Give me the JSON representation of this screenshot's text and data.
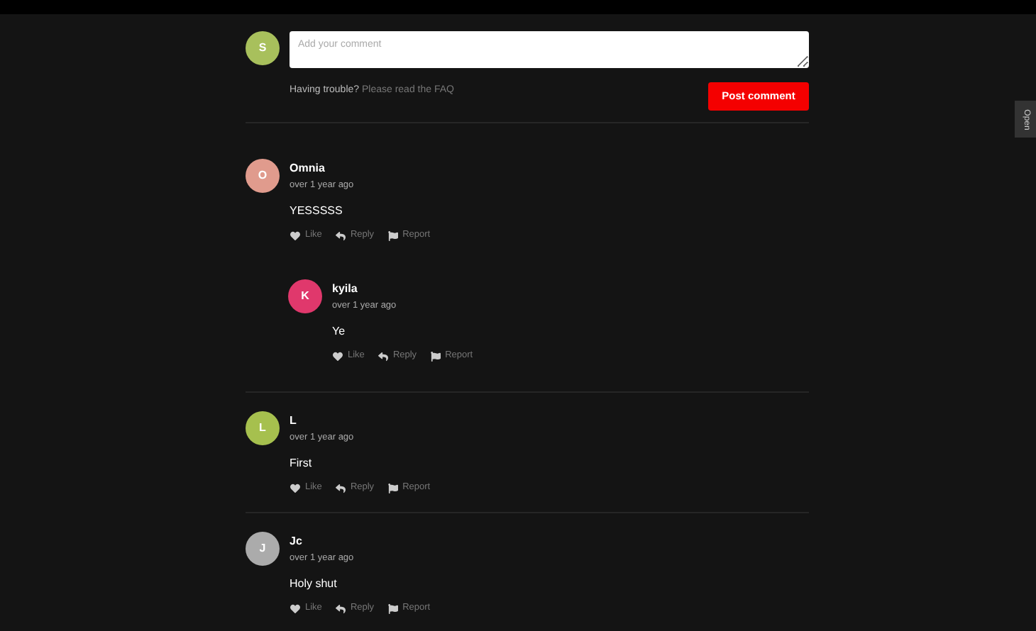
{
  "composer": {
    "avatar": {
      "letter": "S",
      "color": "#a8c05c"
    },
    "placeholder": "Add your comment",
    "help_text": "Having trouble?",
    "help_link": "Please read the FAQ",
    "submit": "Post comment"
  },
  "side_tab": {
    "label": "Open"
  },
  "comments": [
    {
      "avatar": {
        "letter": "O",
        "color": "#e09b8d"
      },
      "author": "Omnia",
      "time": "over 1 year ago",
      "body": "YESSSSS",
      "actions": [
        "Like",
        "Reply",
        "Report"
      ],
      "children": [
        {
          "avatar": {
            "letter": "K",
            "color": "#e0386c"
          },
          "author": "kyila",
          "time": "over 1 year ago",
          "body": "Ye",
          "actions": [
            "Like",
            "Reply",
            "Report"
          ]
        }
      ]
    },
    {
      "avatar": {
        "letter": "L",
        "color": "#a6c04e"
      },
      "author": "L",
      "time": "over 1 year ago",
      "body": "First",
      "actions": [
        "Like",
        "Reply",
        "Report"
      ]
    },
    {
      "avatar": {
        "letter": "J",
        "color": "#ababab"
      },
      "author": "Jc",
      "time": "over 1 year ago",
      "body": "Holy shut",
      "actions": [
        "Like",
        "Reply",
        "Report"
      ]
    }
  ]
}
